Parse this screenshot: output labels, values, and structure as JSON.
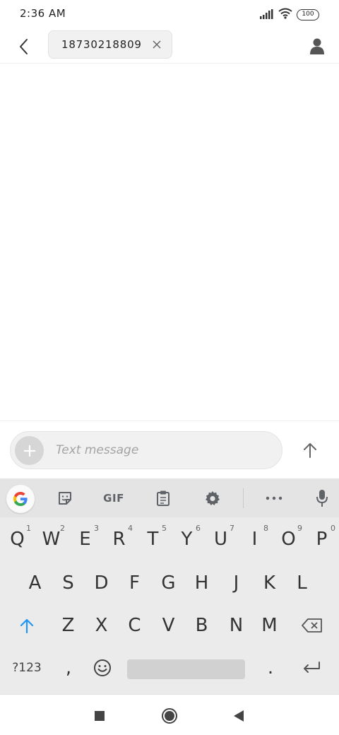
{
  "status_bar": {
    "time": "2:36 AM",
    "battery": "100"
  },
  "header": {
    "recipient": "18730218809"
  },
  "composer": {
    "placeholder": "Text message"
  },
  "keyboard": {
    "toolbar": {
      "gif_label": "GIF"
    },
    "row1": [
      {
        "key": "Q",
        "hint": "1"
      },
      {
        "key": "W",
        "hint": "2"
      },
      {
        "key": "E",
        "hint": "3"
      },
      {
        "key": "R",
        "hint": "4"
      },
      {
        "key": "T",
        "hint": "5"
      },
      {
        "key": "Y",
        "hint": "6"
      },
      {
        "key": "U",
        "hint": "7"
      },
      {
        "key": "I",
        "hint": "8"
      },
      {
        "key": "O",
        "hint": "9"
      },
      {
        "key": "P",
        "hint": "0"
      }
    ],
    "row2": [
      "A",
      "S",
      "D",
      "F",
      "G",
      "H",
      "J",
      "K",
      "L"
    ],
    "row3": [
      "Z",
      "X",
      "C",
      "V",
      "B",
      "N",
      "M"
    ],
    "row4": {
      "symbols": "?123",
      "comma": ",",
      "period": "."
    }
  },
  "colors": {
    "shift_accent": "#2196f3",
    "google_blue": "#4285f4",
    "google_red": "#ea4335",
    "google_yellow": "#fbbc05",
    "google_green": "#34a853"
  }
}
